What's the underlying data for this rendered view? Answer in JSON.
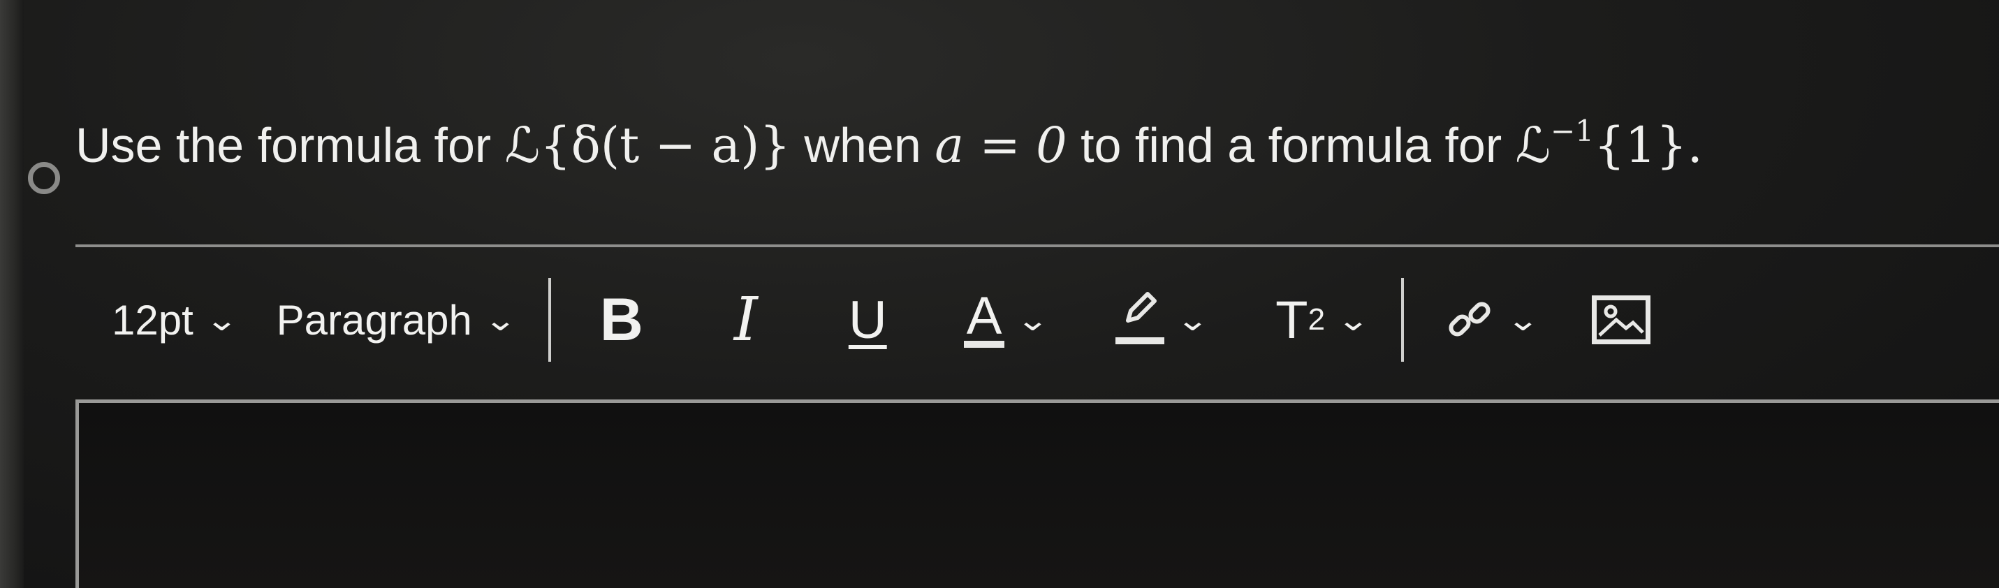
{
  "question": {
    "prefix": "Use the formula for ",
    "expr1": "ℒ{δ(t − a)}",
    "middle1": " when ",
    "expr2": "a = 0",
    "middle2": " to find a formula for ",
    "expr3_base": "ℒ",
    "expr3_sup": "−1",
    "expr3_tail": "{1}.",
    "icons": {
      "selector": "radio-circle-icon"
    }
  },
  "toolbar": {
    "font_size": "12pt",
    "block_format": "Paragraph",
    "bold_label": "B",
    "italic_label": "I",
    "underline_label": "U",
    "text_color_label": "A",
    "superscript_base": "T",
    "superscript_sup": "2",
    "icons": {
      "dropdown": "chevron-down-icon",
      "highlight": "highlighter-icon",
      "link": "link-icon",
      "image": "image-icon"
    }
  },
  "editor": {
    "content": ""
  },
  "colors": {
    "background": "#1c1c1b",
    "text": "#f0f0ee",
    "rule": "#8e8e8c"
  }
}
